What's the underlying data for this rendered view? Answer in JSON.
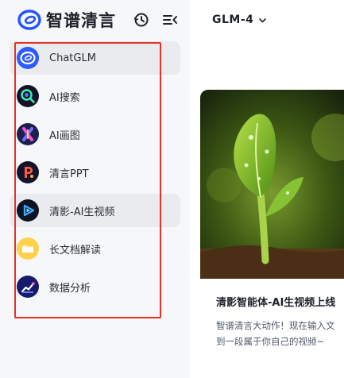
{
  "brand": {
    "name": "智谱清言"
  },
  "header_icons": [
    "history-icon",
    "collapse-sidebar-icon"
  ],
  "nav": {
    "items": [
      {
        "label": "ChatGLM",
        "icon": "chatglm-icon",
        "active": true
      },
      {
        "label": "AI搜索",
        "icon": "ai-search-icon",
        "active": false
      },
      {
        "label": "AI画图",
        "icon": "ai-drawing-icon",
        "active": false
      },
      {
        "label": "清言PPT",
        "icon": "ppt-icon",
        "active": false
      },
      {
        "label": "清影-AI生视频",
        "icon": "video-icon",
        "active": true
      },
      {
        "label": "长文档解读",
        "icon": "document-icon",
        "active": false
      },
      {
        "label": "数据分析",
        "icon": "data-analysis-icon",
        "active": false
      }
    ]
  },
  "main": {
    "model_select": {
      "value": "GLM-4"
    },
    "card": {
      "title": "清影智能体-AI生视频上线",
      "desc_line1": "智谱清言大动作！现在输入文",
      "desc_line2": "到一段属于你自己的视频~"
    }
  },
  "colors": {
    "accent": "#2454ff",
    "highlight_box": "#e6312b",
    "sidebar_bg": "#f6f7f9"
  }
}
